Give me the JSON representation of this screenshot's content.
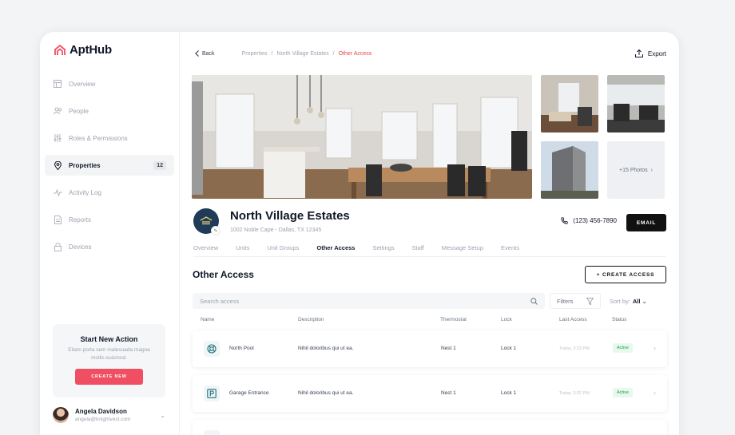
{
  "app": {
    "name": "AptHub"
  },
  "sidebar": {
    "items": [
      {
        "label": "Overview",
        "icon": "layout-icon"
      },
      {
        "label": "People",
        "icon": "people-icon"
      },
      {
        "label": "Roles & Permissions",
        "icon": "sliders-icon"
      },
      {
        "label": "Properties",
        "icon": "location-pin-icon",
        "badge": "12",
        "active": true
      },
      {
        "label": "Activity Log",
        "icon": "activity-icon"
      },
      {
        "label": "Reports",
        "icon": "document-icon"
      },
      {
        "label": "Devices",
        "icon": "lock-icon"
      }
    ],
    "action_card": {
      "title": "Start New Action",
      "description": "Etiam porta sem malesuada magna mollis euismod.",
      "button": "CREATE NEW"
    },
    "user": {
      "name": "Angela Davidson",
      "email": "angela@knightvest.com"
    }
  },
  "topbar": {
    "back": "Back",
    "breadcrumb": [
      "Properties",
      "North Village Estates"
    ],
    "breadcrumb_current": "Other Access",
    "export": "Export"
  },
  "gallery": {
    "more": "+15 Photos"
  },
  "property": {
    "name": "North Village Estates",
    "address": "1002 Noble Cape - Dallas, TX 12345",
    "phone": "(123) 456-7890",
    "email_button": "EMAIL"
  },
  "tabs": [
    "Overview",
    "Units",
    "Unit Groups",
    "Other Access",
    "Settings",
    "Staff",
    "Message Setup",
    "Events"
  ],
  "active_tab": "Other Access",
  "section": {
    "title": "Other Access",
    "create_button": "+ CREATE ACCESS",
    "search_placeholder": "Search access",
    "filters": "Filters",
    "sort_label": "Sort by:",
    "sort_value": "All"
  },
  "table": {
    "headers": [
      "Name",
      "Description",
      "Thermostat",
      "Lock",
      "Last Access",
      "Status"
    ],
    "rows": [
      {
        "icon": "pool-icon",
        "name": "North Pool",
        "description": "Nihil doloribus qui ut ea.",
        "thermostat": "Nest 1",
        "lock": "Lock 1",
        "last_access": "Today, 3:32 PM",
        "status": "Active"
      },
      {
        "icon": "parking-icon",
        "name": "Garage Entrance",
        "description": "Nihil doloribus qui ut ea.",
        "thermostat": "Nest 1",
        "lock": "Lock 1",
        "last_access": "Today, 3:32 PM",
        "status": "Active"
      }
    ]
  },
  "colors": {
    "accent": "#f04e63",
    "breadcrumb_current": "#ef4444",
    "status_active": "#16a34a",
    "brand_navy": "#1f3b57"
  }
}
